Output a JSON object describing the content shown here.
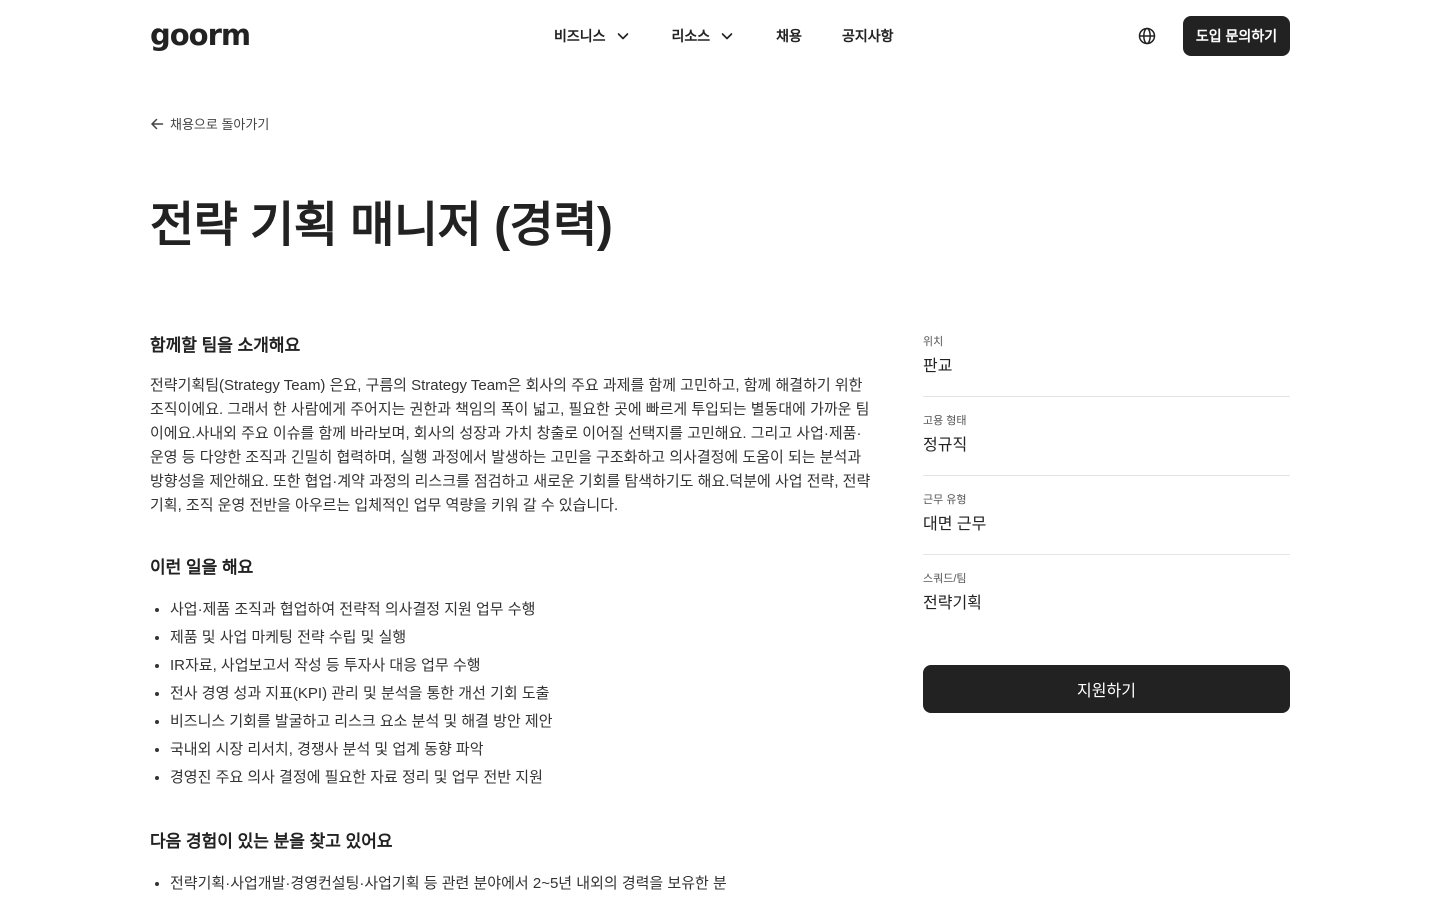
{
  "header": {
    "logo": "goorm",
    "nav": [
      {
        "label": "비즈니스",
        "has_dropdown": true
      },
      {
        "label": "리소스",
        "has_dropdown": true
      },
      {
        "label": "채용",
        "has_dropdown": false
      },
      {
        "label": "공지사항",
        "has_dropdown": false
      }
    ],
    "globe_icon": "globe-icon",
    "cta_label": "도입 문의하기"
  },
  "back_link": {
    "icon": "arrow-left-icon",
    "label": "채용으로 돌아가기"
  },
  "page_title": "전략 기획 매니저 (경력)",
  "sections": {
    "team": {
      "heading": "함께할 팀을 소개해요",
      "body": "전략기획팀(Strategy Team) 은요, 구름의 Strategy Team은 회사의 주요 과제를 함께 고민하고, 함께 해결하기 위한 조직이에요. 그래서 한 사람에게 주어지는 권한과 책임의 폭이 넓고, 필요한 곳에 빠르게 투입되는 별동대에 가까운 팀이에요.사내외 주요 이슈를 함께 바라보며, 회사의 성장과 가치 창출로 이어질 선택지를 고민해요. 그리고 사업·제품·운영 등 다양한 조직과 긴밀히 협력하며, 실행 과정에서 발생하는 고민을 구조화하고 의사결정에 도움이 되는 분석과 방향성을 제안해요. 또한 협업·계약 과정의 리스크를 점검하고 새로운 기회를 탐색하기도 해요.덕분에 사업 전략, 전략 기획, 조직 운영 전반을 아우르는 입체적인 업무 역량을 키워 갈 수 있습니다."
    },
    "work": {
      "heading": "이런 일을 해요",
      "items": [
        "사업·제품 조직과 협업하여 전략적 의사결정 지원 업무 수행",
        "제품 및 사업 마케팅 전략 수립 및 실행",
        "IR자료, 사업보고서 작성 등 투자사 대응 업무 수행",
        "전사 경영 성과 지표(KPI) 관리 및 분석을 통한 개선 기회 도출",
        "비즈니스 기회를 발굴하고 리스크 요소 분석 및 해결 방안 제안",
        "국내외 시장 리서치, 경쟁사 분석 및 업계 동향 파악",
        "경영진 주요 의사 결정에 필요한 자료 정리 및 업무 전반 지원"
      ]
    },
    "experience": {
      "heading": "다음 경험이 있는 분을 찾고 있어요",
      "items": [
        "전략기획·사업개발·경영컨설팅·사업기획 등 관련 분야에서 2~5년 내외의 경력을 보유한 분"
      ]
    }
  },
  "sidebar": {
    "meta": [
      {
        "label": "위치",
        "value": "판교"
      },
      {
        "label": "고용 형태",
        "value": "정규직"
      },
      {
        "label": "근무 유형",
        "value": "대면 근무"
      },
      {
        "label": "스쿼드/팀",
        "value": "전략기획"
      }
    ],
    "apply_label": "지원하기"
  }
}
